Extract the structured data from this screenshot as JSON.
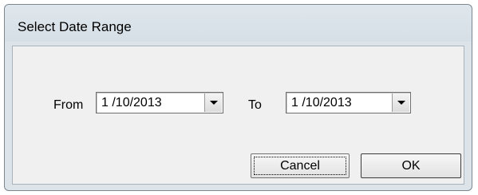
{
  "dialog": {
    "title": "Select Date Range"
  },
  "range": {
    "from_label": "From",
    "from_value": "1 /10/2013",
    "to_label": "To",
    "to_value": "1 /10/2013"
  },
  "buttons": {
    "cancel_label": "Cancel",
    "ok_label": "OK"
  },
  "icons": {
    "dropdown": "chevron-down-icon"
  }
}
